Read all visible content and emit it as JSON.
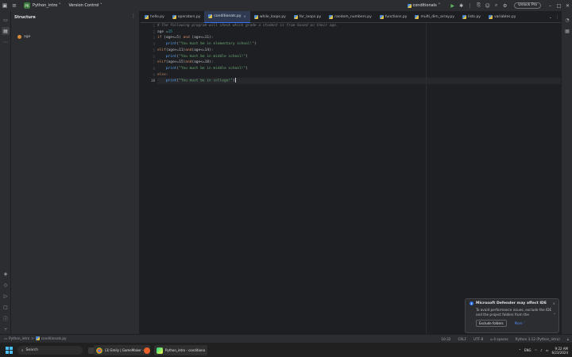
{
  "titlebar": {
    "project_badge": "PR",
    "project_name": "Python_intro",
    "vcs": "Version Control",
    "run_config": "conditionals",
    "unlock_label": "Unlock Pro",
    "chevron": "˅"
  },
  "structure": {
    "title": "Structure",
    "menu": "⋮",
    "items": [
      {
        "label": "age"
      }
    ]
  },
  "tabs": [
    {
      "label": "hello.py",
      "active": false
    },
    {
      "label": "operators.py",
      "active": false
    },
    {
      "label": "conditionals.py",
      "active": true
    },
    {
      "label": "while_loops.py",
      "active": false
    },
    {
      "label": "for_loops.py",
      "active": false
    },
    {
      "label": "random_numbers.py",
      "active": false
    },
    {
      "label": "functions.py",
      "active": false
    },
    {
      "label": "multi_dim_array.py",
      "active": false
    },
    {
      "label": "lists.py",
      "active": false
    },
    {
      "label": "variables.py",
      "active": false
    }
  ],
  "editor": {
    "line_numbers": [
      "1",
      "2",
      "3",
      "4",
      "5",
      "6",
      "7",
      "8",
      "9",
      "10"
    ],
    "current_line": "10",
    "code": {
      "l1": "# The following program will check which grade a student is from based on their age.",
      "l2a": "age ",
      "l2b": "=",
      "l2c": "15",
      "l3a": "if ",
      "l3b": "(age<=5) ",
      "l3c": "and ",
      "l3d": "(age<=11):",
      "l4a": "    ",
      "l4b": "print",
      "l4c": "(",
      "l4d": "\"You must be in elementary school!\"",
      "l4e": ")",
      "l5a": "elif",
      "l5b": "(age>=11)",
      "l5c": "and",
      "l5d": "(age<=14):",
      "l6a": "    ",
      "l6b": "print",
      "l6c": "(",
      "l6d": "\"You must be in middle school!\"",
      "l6e": ")",
      "l7a": "elif",
      "l7b": "(age>=15)",
      "l7c": "and",
      "l7d": "(age<=18):",
      "l8a": "    ",
      "l8b": "print",
      "l8c": "(",
      "l8d": "\"You must be in middle school!\"",
      "l8e": ")",
      "l9": "else:",
      "l10a": "    ",
      "l10b": "print",
      "l10c": "(",
      "l10d": "\"You must be in college!\"",
      "l10e": ")"
    }
  },
  "notification": {
    "title": "Microsoft Defender may affect IDE",
    "body": "To avoid performance issues, exclude the IDE and the project folders from the",
    "primary_action": "Exclude folders",
    "secondary_action": "More ˅",
    "close": "×",
    "chevron": "˅"
  },
  "statusbar": {
    "breadcrumb_root": "Python_intro",
    "breadcrumb_sep": ">",
    "breadcrumb_file": "conditionals.py",
    "position": "10:32",
    "line_sep": "CRLF",
    "encoding": "UTF-8",
    "indent": "4 spaces",
    "interpreter": "Python 3.12 (Python_intro)"
  },
  "taskbar": {
    "search_placeholder": "Search",
    "apps": [
      {
        "label": "(3) Emily | GameMaker - Yo"
      },
      {
        "label": "Python_intro - conditiona"
      }
    ],
    "clock_time": "9:22 AM",
    "clock_date": "6/23/2024",
    "lang": "ENG"
  },
  "colors": {
    "accent": "#3574f0",
    "run_green": "#5fb865",
    "keyword": "#cf8e6d",
    "string": "#6aab73",
    "function": "#56a8f5",
    "number": "#2aacb8"
  }
}
